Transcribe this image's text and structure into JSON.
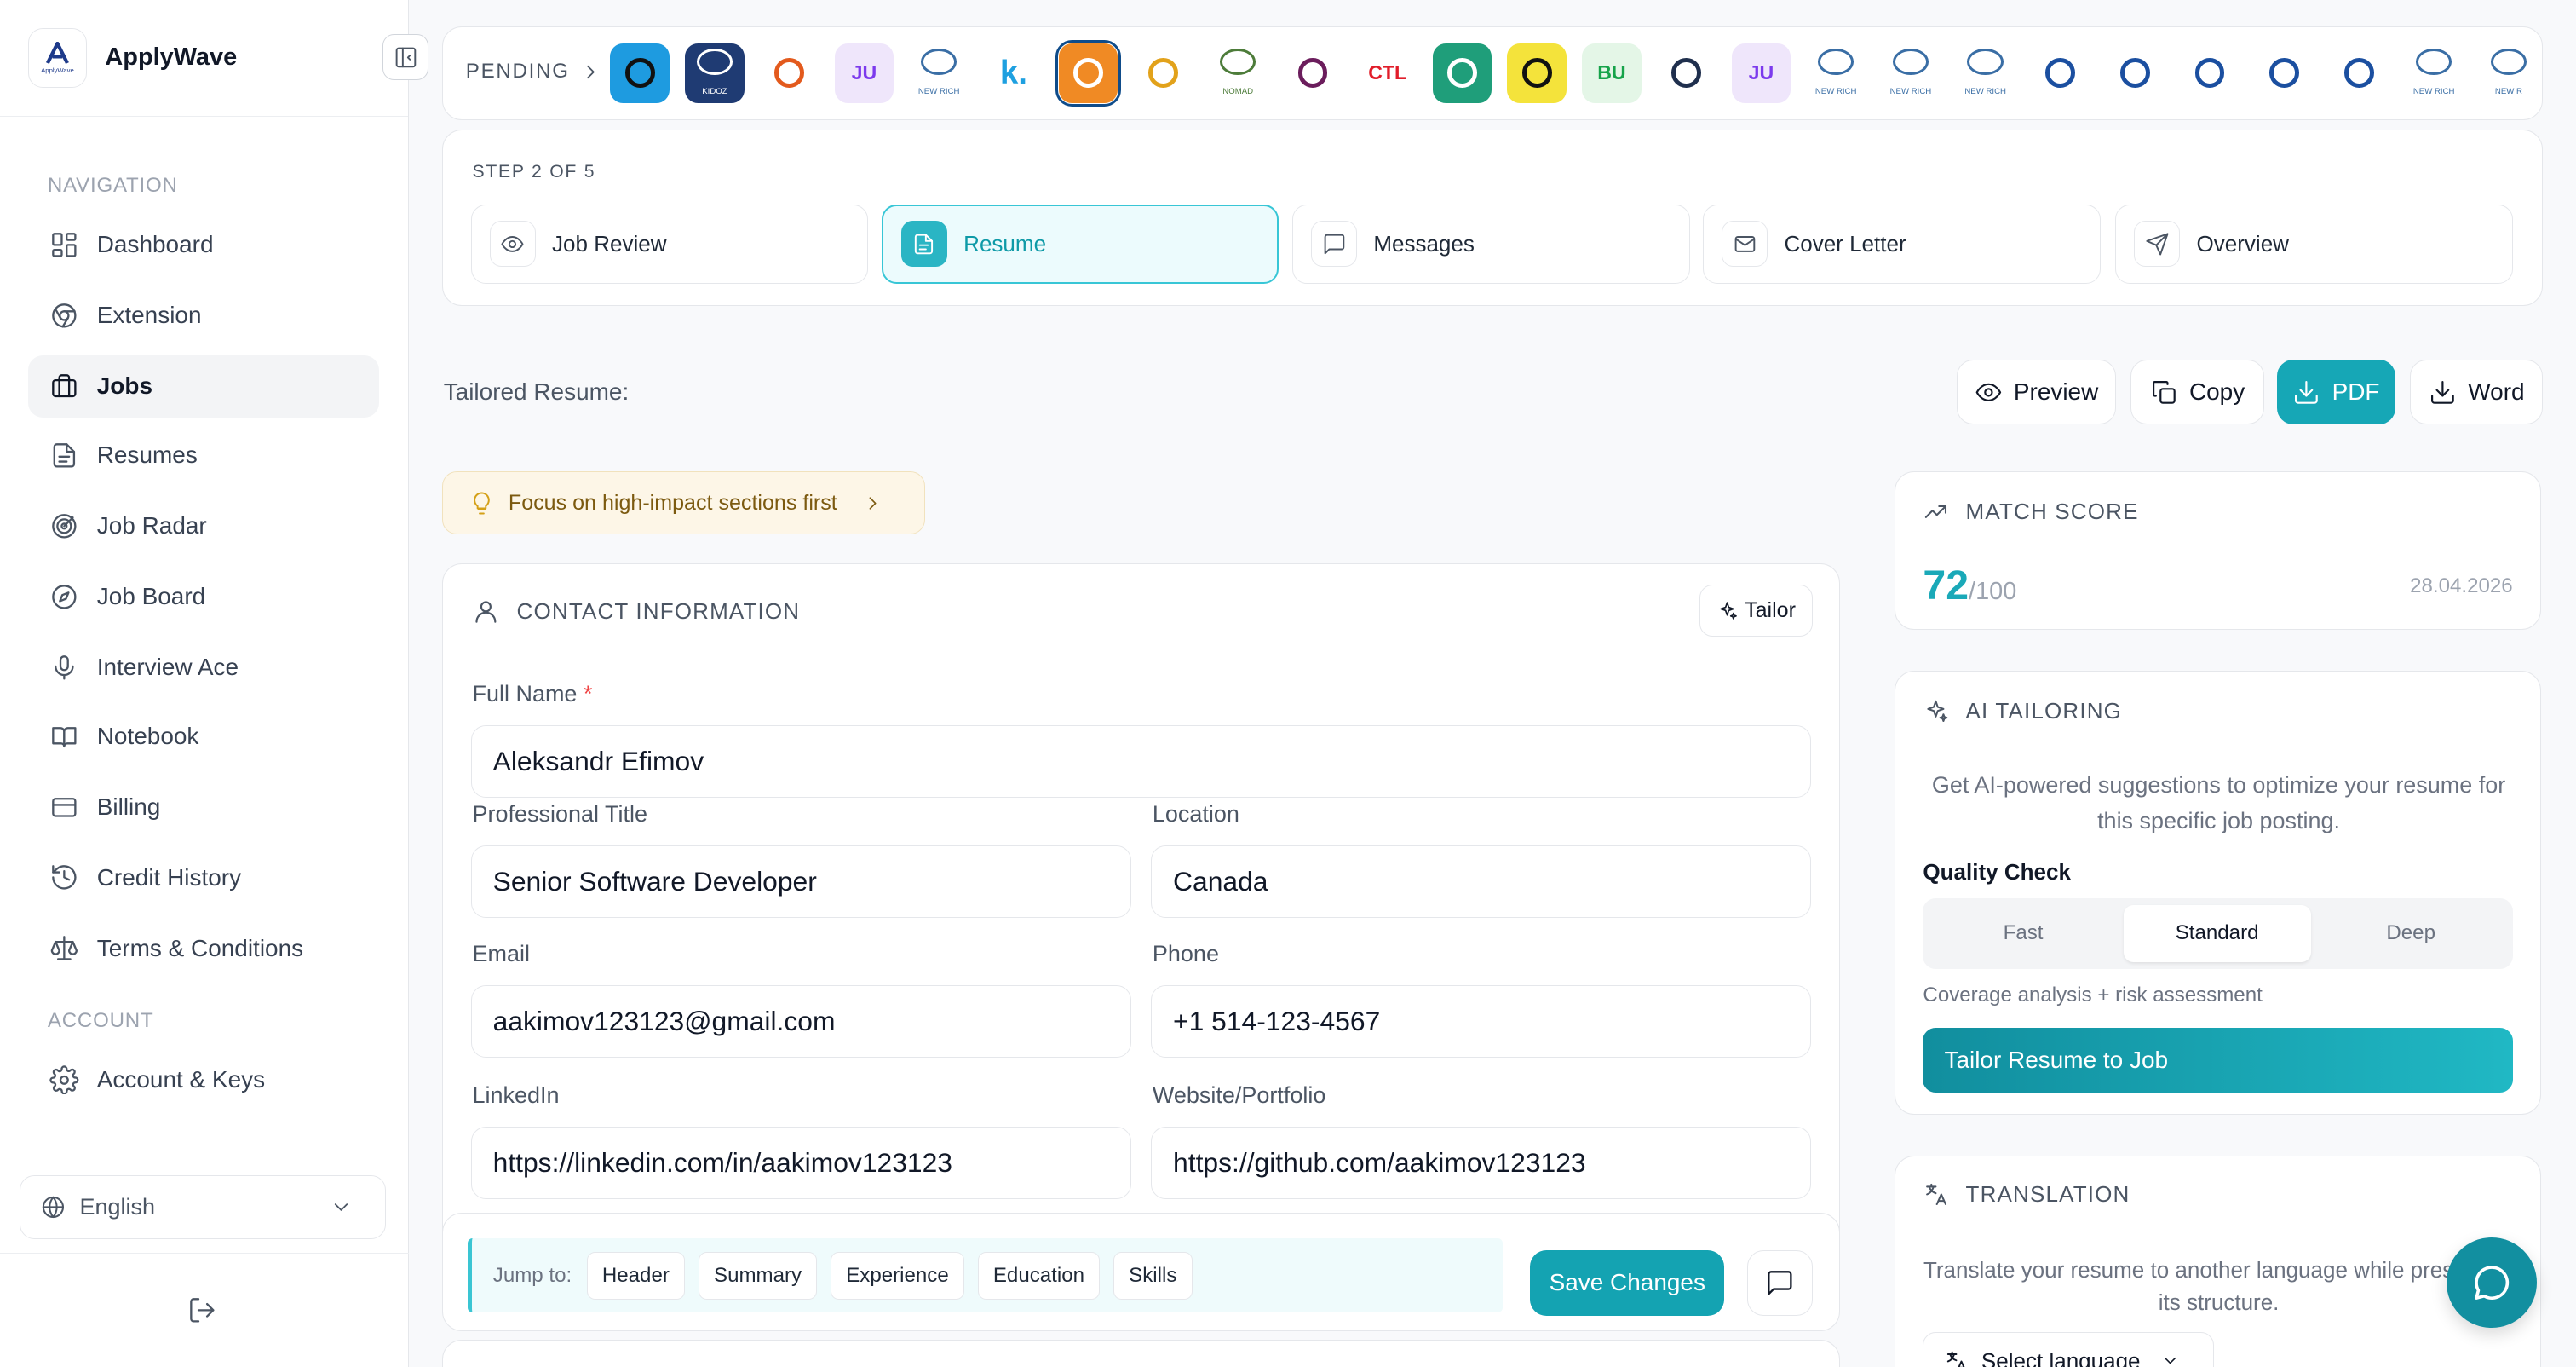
{
  "brand": {
    "name": "ApplyWave",
    "logo_text": "ApplyWave",
    "logo_letter": "A"
  },
  "sidebar": {
    "nav_label": "NAVIGATION",
    "items": [
      {
        "label": "Dashboard",
        "icon": "dashboard-icon"
      },
      {
        "label": "Extension",
        "icon": "chrome-icon"
      },
      {
        "label": "Jobs",
        "icon": "briefcase-icon",
        "active": true
      },
      {
        "label": "Resumes",
        "icon": "file-icon"
      },
      {
        "label": "Job Radar",
        "icon": "radar-icon"
      },
      {
        "label": "Job Board",
        "icon": "compass-icon"
      },
      {
        "label": "Interview Ace",
        "icon": "mic-icon"
      },
      {
        "label": "Notebook",
        "icon": "book-icon"
      },
      {
        "label": "Billing",
        "icon": "credit-card-icon"
      },
      {
        "label": "Credit History",
        "icon": "history-icon"
      },
      {
        "label": "Terms & Conditions",
        "icon": "scale-icon"
      }
    ],
    "account_label": "ACCOUNT",
    "account_items": [
      {
        "label": "Account & Keys",
        "icon": "gear-icon"
      }
    ],
    "language": "English"
  },
  "pending": {
    "label": "PENDING",
    "logos": [
      {
        "text": "",
        "bg": "#1e9be0",
        "fg": "#111"
      },
      {
        "text": "KIDOZ",
        "bg": "#1f3b73",
        "fg": "#fff"
      },
      {
        "text": "",
        "bg": "#fff",
        "fg": "#e35a1d"
      },
      {
        "text": "JU",
        "bg": "#efe6fb",
        "fg": "#7c3aed"
      },
      {
        "text": "NEW RICH",
        "bg": "#fff",
        "fg": "#3a6ea5"
      },
      {
        "text": "k.",
        "bg": "#fff",
        "fg": "#1ea0e0"
      },
      {
        "text": "",
        "bg": "#f08a24",
        "fg": "#fff",
        "selected": true
      },
      {
        "text": "",
        "bg": "#fff",
        "fg": "#e2a21b"
      },
      {
        "text": "NOMAD",
        "bg": "#fff",
        "fg": "#4d7c3a"
      },
      {
        "text": "",
        "bg": "#fff",
        "fg": "#6b1d5c"
      },
      {
        "text": "CTL",
        "bg": "#fff",
        "fg": "#e11d2a"
      },
      {
        "text": "",
        "bg": "#1f9e7a",
        "fg": "#fff"
      },
      {
        "text": "",
        "bg": "#f4e33b",
        "fg": "#111"
      },
      {
        "text": "BU",
        "bg": "#e4f6e7",
        "fg": "#16a34a"
      },
      {
        "text": "",
        "bg": "#fff",
        "fg": "#1f2f4d"
      },
      {
        "text": "JU",
        "bg": "#efe6fb",
        "fg": "#7c3aed"
      },
      {
        "text": "NEW RICH",
        "bg": "#fff",
        "fg": "#3a6ea5"
      },
      {
        "text": "NEW RICH",
        "bg": "#fff",
        "fg": "#3a6ea5"
      },
      {
        "text": "NEW RICH",
        "bg": "#fff",
        "fg": "#3a6ea5"
      },
      {
        "text": "",
        "bg": "#fff",
        "fg": "#1b4fa0"
      },
      {
        "text": "",
        "bg": "#fff",
        "fg": "#1b4fa0"
      },
      {
        "text": "",
        "bg": "#fff",
        "fg": "#1b4fa0"
      },
      {
        "text": "",
        "bg": "#fff",
        "fg": "#1b4fa0"
      },
      {
        "text": "",
        "bg": "#fff",
        "fg": "#1b4fa0"
      },
      {
        "text": "NEW RICH",
        "bg": "#fff",
        "fg": "#3a6ea5"
      },
      {
        "text": "NEW R",
        "bg": "#fff",
        "fg": "#3a6ea5"
      }
    ]
  },
  "steps": {
    "label": "STEP 2 OF 5",
    "items": [
      {
        "label": "Job Review",
        "icon": "eye-icon"
      },
      {
        "label": "Resume",
        "icon": "file-icon",
        "active": true
      },
      {
        "label": "Messages",
        "icon": "message-icon"
      },
      {
        "label": "Cover Letter",
        "icon": "mail-icon"
      },
      {
        "label": "Overview",
        "icon": "send-icon"
      }
    ]
  },
  "toolbar": {
    "title": "Tailored Resume:",
    "preview": "Preview",
    "copy": "Copy",
    "pdf": "PDF",
    "word": "Word"
  },
  "tip": {
    "text": "Focus on high-impact sections first"
  },
  "contact": {
    "title": "CONTACT INFORMATION",
    "tailor": "Tailor",
    "full_name_label": "Full Name",
    "required_mark": "*",
    "full_name": "Aleksandr Efimov",
    "title_label": "Professional Title",
    "professional_title": "Senior Software Developer",
    "location_label": "Location",
    "location": "Canada",
    "email_label": "Email",
    "email": "aakimov123123@gmail.com",
    "phone_label": "Phone",
    "phone": "+1 514-123-4567",
    "linkedin_label": "LinkedIn",
    "linkedin": "https://linkedin.com/in/aakimov123123",
    "website_label": "Website/Portfolio",
    "website": "https://github.com/aakimov123123"
  },
  "bottom": {
    "jump_label": "Jump to:",
    "chips": [
      "Header",
      "Summary",
      "Experience",
      "Education",
      "Skills"
    ],
    "save": "Save Changes"
  },
  "match": {
    "title": "MATCH SCORE",
    "score": "72",
    "max": "/100",
    "date": "28.04.2026"
  },
  "ai": {
    "title": "AI TAILORING",
    "desc": "Get AI-powered suggestions to optimize your resume for this specific job posting.",
    "quality_label": "Quality Check",
    "options": [
      "Fast",
      "Standard",
      "Deep"
    ],
    "selected": "Standard",
    "hint": "Coverage analysis + risk assessment",
    "button": "Tailor Resume to Job"
  },
  "translation": {
    "title": "TRANSLATION",
    "desc": "Translate your resume to another language while preserving its structure.",
    "select_placeholder": "Select language"
  },
  "colors": {
    "accent": "#16a7b6",
    "active_step_bg": "#ecfbfd",
    "tip_bg": "#fdf6e7"
  }
}
